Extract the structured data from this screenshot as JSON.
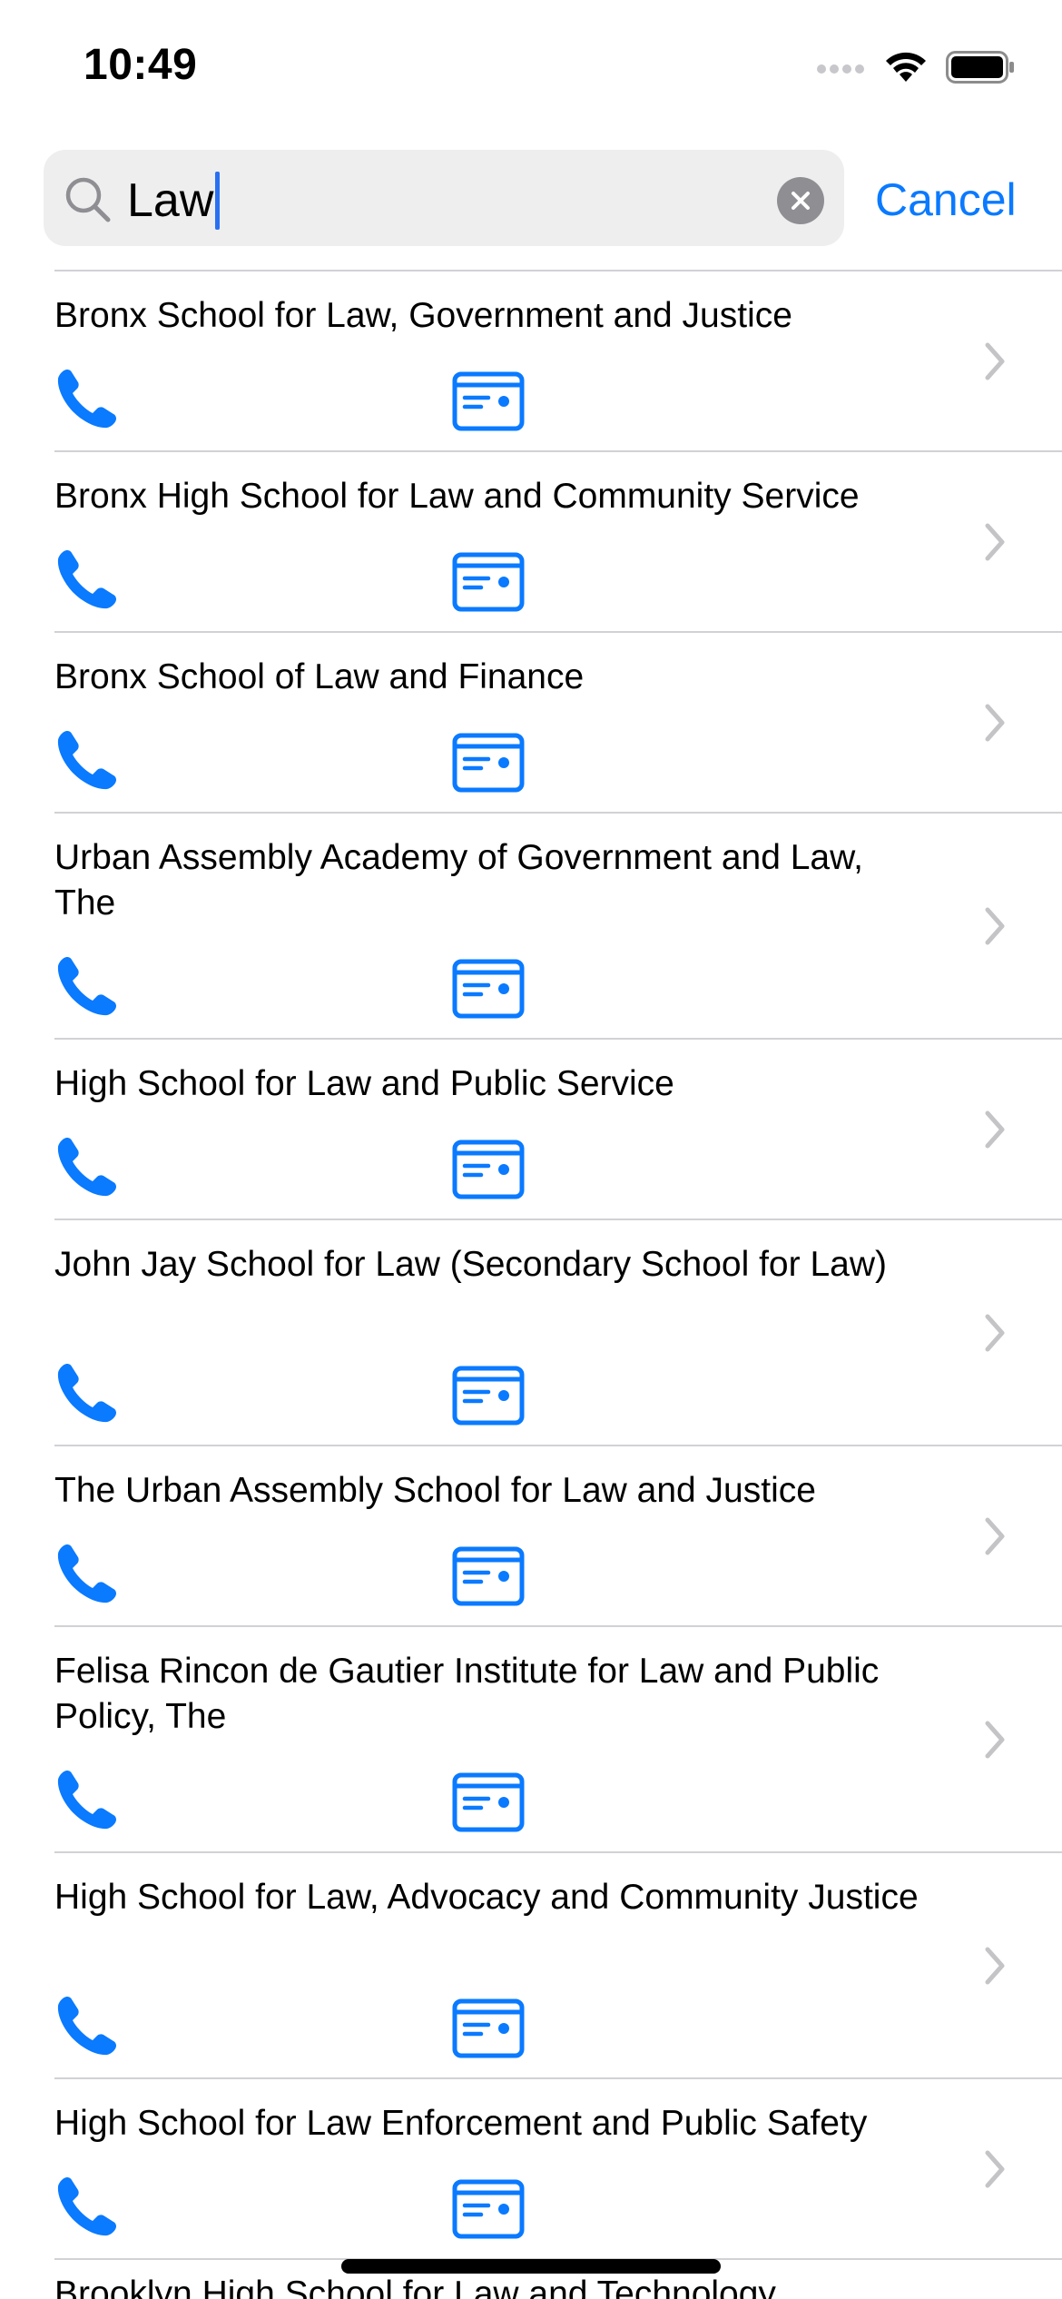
{
  "status_bar": {
    "time": "10:49"
  },
  "search": {
    "query": "Law",
    "cancel_label": "Cancel"
  },
  "colors": {
    "accent": "#0a7aff",
    "chevron": "#c4c4c7",
    "separator": "#d1d1d6",
    "search_bg": "#eeeeef"
  },
  "icons": {
    "row_phone": "phone-icon",
    "row_card": "school-card-icon",
    "row_chevron": "chevron-right-icon"
  },
  "results": [
    {
      "name": "Bronx School for Law, Government and Justice"
    },
    {
      "name": "Bronx High School for Law and Community Service"
    },
    {
      "name": "Bronx School of Law and Finance"
    },
    {
      "name": "Urban Assembly Academy of Government and Law, The"
    },
    {
      "name": "High School for Law and Public Service"
    },
    {
      "name": "John Jay School for Law (Secondary School for Law)"
    },
    {
      "name": "The Urban Assembly School for Law and Justice"
    },
    {
      "name": "Felisa Rincon de Gautier Institute for Law and Public Policy, The"
    },
    {
      "name": "High School for Law, Advocacy and Community Justice"
    },
    {
      "name": "High School for Law Enforcement and Public Safety"
    },
    {
      "name": "Brooklyn High School for Law and Technology"
    }
  ]
}
